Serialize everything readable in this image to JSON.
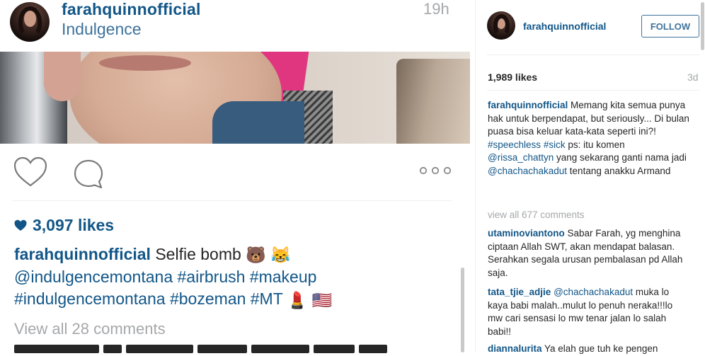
{
  "post": {
    "username": "farahquinnofficial",
    "location": "Indulgence",
    "time": "19h",
    "likes": "3,097 likes",
    "caption_user": "farahquinnofficial",
    "caption_text": "Selfie bomb",
    "caption_hashtags_line1": [
      "@indulgencemontana",
      "#airbrush",
      "#makeup"
    ],
    "caption_hashtags_line2": [
      "#indulgencemontana",
      "#bozeman",
      "#MT"
    ],
    "emoji_bear": "🐻",
    "emoji_laugh": "😹",
    "emoji_lipstick": "💄",
    "emoji_flag": "🇺🇸",
    "view_all": "View all 28 comments"
  },
  "panel": {
    "username": "farahquinnofficial",
    "follow_label": "FOLLOW",
    "likes": "1,989 likes",
    "time": "3d",
    "caption_user": "farahquinnofficial",
    "caption_part1": "Memang kita semua punya hak untuk berpendapat, but seriously... Di bulan puasa bisa keluar kata-kata seperti ini?!",
    "caption_tag1": "#speechless",
    "caption_tag2": "#sick",
    "caption_part2": "ps: itu komen",
    "caption_mention1": "@rissa_chattyn",
    "caption_part3": "yang sekarang ganti nama jadi",
    "caption_mention2": "@chachachakadut",
    "caption_part4": "tentang anakku Armand",
    "view_all": "view all 677 comments",
    "comments": [
      {
        "user": "utaminoviantono",
        "mention": "",
        "text": "Sabar Farah, yg menghina ciptaan Allah SWT, akan mendapat balasan. Serahkan segala urusan pembalasan pd Allah saja."
      },
      {
        "user": "tata_tjie_adjie",
        "mention": "@chachachakadut",
        "text": "muka lo kaya babi malah..mulut lo penuh neraka!!!lo mw cari sensasi lo mw tenar jalan lo salah babi!!"
      },
      {
        "user": "diannalurita",
        "mention": "",
        "text": "Ya elah gue tuh ke pengen"
      }
    ]
  },
  "colors": {
    "link": "#125688",
    "location": "#3f729b",
    "muted": "#a5a7aa",
    "text": "#262626"
  }
}
